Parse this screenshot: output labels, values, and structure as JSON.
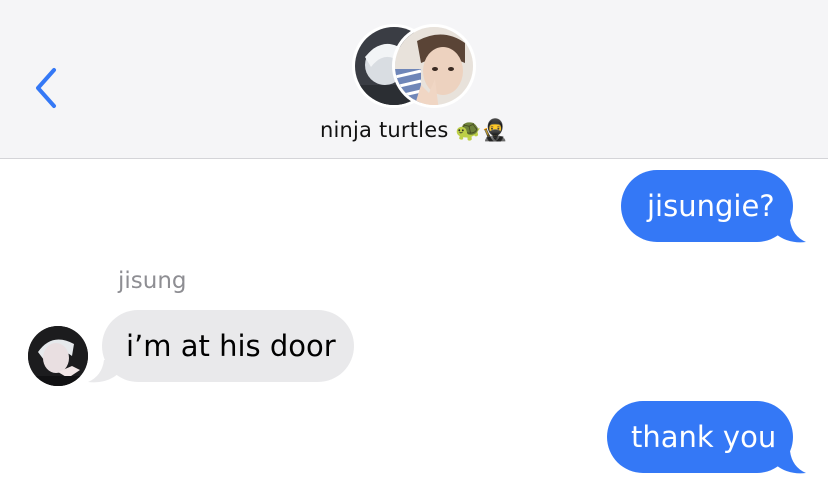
{
  "header": {
    "back_icon": "chevron-left-icon",
    "group_name": "ninja turtles 🐢🥷",
    "accent_color": "#3478f6"
  },
  "messages": [
    {
      "direction": "outgoing",
      "text": "jisungie?"
    },
    {
      "direction": "incoming",
      "sender": "jisung",
      "text": "i’m at his door"
    },
    {
      "direction": "outgoing",
      "text": "thank you"
    }
  ],
  "colors": {
    "outgoing_bubble": "#3478f6",
    "incoming_bubble": "#e9e9eb",
    "header_background": "#f5f5f7"
  }
}
